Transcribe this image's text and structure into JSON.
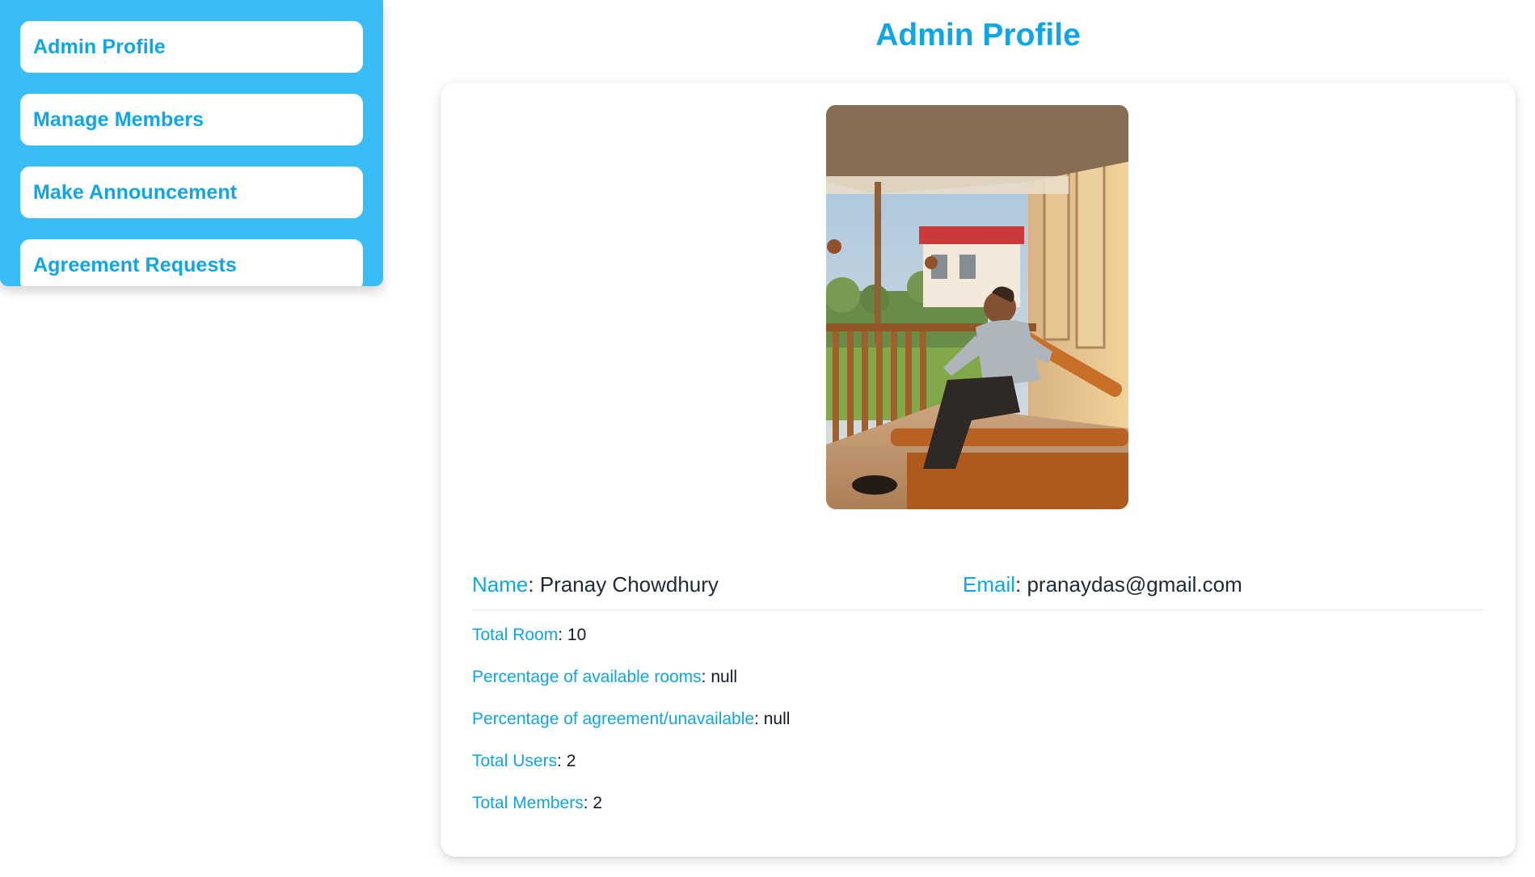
{
  "sidebar": {
    "items": [
      {
        "label": "Admin Profile"
      },
      {
        "label": "Manage Members"
      },
      {
        "label": "Make Announcement"
      },
      {
        "label": "Agreement Requests"
      }
    ]
  },
  "main": {
    "title": "Admin Profile",
    "profile": {
      "name_label": "Name",
      "name_value": "Pranay Chowdhury",
      "email_label": "Email",
      "email_value": "pranaydas@gmail.com"
    },
    "stats": [
      {
        "label": "Total Room",
        "value": "10"
      },
      {
        "label": "Percentage of available rooms",
        "value": "null"
      },
      {
        "label": "Percentage of agreement/unavailable",
        "value": "null"
      },
      {
        "label": "Total Users",
        "value": "2"
      },
      {
        "label": "Total Members",
        "value": "2"
      }
    ]
  },
  "colors": {
    "accent": "#0ea5e9",
    "sidebar_bg": "#38bdf8",
    "text": "#1f2937"
  }
}
